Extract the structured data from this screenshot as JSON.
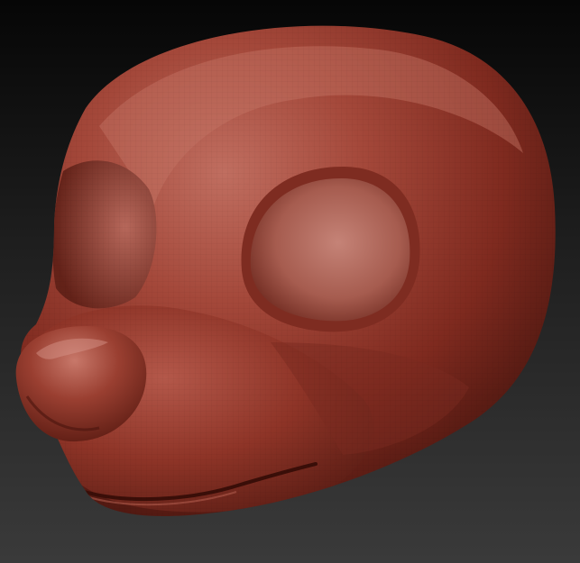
{
  "viewport": {
    "background_top": "#060606",
    "background_bottom": "#3a3a3a"
  },
  "model": {
    "subject": "sculpted-animal-head",
    "material_color": "#8e2f22",
    "highlight_color": "#c97a6c",
    "shadow_color": "#3d110b",
    "wireframe_visible": true
  }
}
